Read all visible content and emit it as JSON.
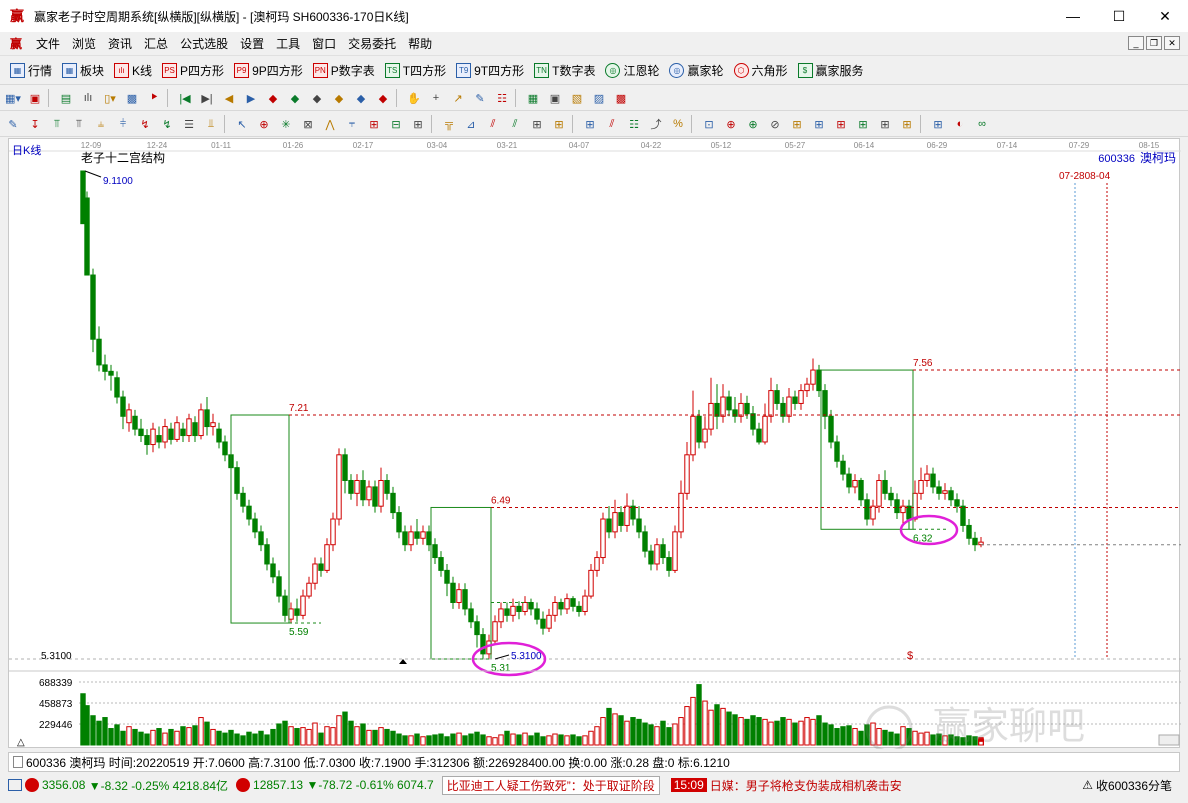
{
  "window": {
    "app_icon_glyph": "赢",
    "title": "赢家老子时空周期系统[纵横版][纵横版] - [澳柯玛  SH600336-170日K线]",
    "minimize": "—",
    "maximize": "☐",
    "close": "✕"
  },
  "menubar": {
    "logo_glyph": "赢",
    "items": [
      "文件",
      "浏览",
      "资讯",
      "汇总",
      "公式选股",
      "设置",
      "工具",
      "窗口",
      "交易委托",
      "帮助"
    ]
  },
  "toolbar1": [
    {
      "icon": "grid-icon",
      "glyph": "▦",
      "label": "行情",
      "tone": ""
    },
    {
      "icon": "blocks-icon",
      "glyph": "▦",
      "label": "板块",
      "tone": ""
    },
    {
      "icon": "candle-icon",
      "glyph": "ılı",
      "label": "K线",
      "tone": "r"
    },
    {
      "icon": "p-square-icon",
      "glyph": "PS",
      "label": "P四方形",
      "tone": "r"
    },
    {
      "icon": "9p-square-icon",
      "glyph": "P9",
      "label": "9P四方形",
      "tone": "r"
    },
    {
      "icon": "pn-table-icon",
      "glyph": "PN",
      "label": "P数字表",
      "tone": "r"
    },
    {
      "icon": "t-square-icon",
      "glyph": "TS",
      "label": "T四方形",
      "tone": "g"
    },
    {
      "icon": "9t-square-icon",
      "glyph": "T9",
      "label": "9T四方形",
      "tone": ""
    },
    {
      "icon": "tn-table-icon",
      "glyph": "TN",
      "label": "T数字表",
      "tone": "g"
    },
    {
      "icon": "gann-wheel-icon",
      "glyph": "◎",
      "label": "江恩轮",
      "tone": "g c"
    },
    {
      "icon": "winner-wheel-icon",
      "glyph": "◎",
      "label": "赢家轮",
      "tone": "c"
    },
    {
      "icon": "hexagon-icon",
      "glyph": "⬡",
      "label": "六角形",
      "tone": "r c"
    },
    {
      "icon": "dollar-icon",
      "glyph": "$",
      "label": "赢家服务",
      "tone": "g"
    }
  ],
  "toolbar2_glyphs": [
    "▦▾",
    "▣",
    "▤",
    "ılı",
    "▯▾",
    "▩",
    "⯈",
    "|◀",
    "▶|",
    "◀",
    "▶",
    "◆",
    "◆",
    "◆",
    "◆",
    "◆",
    "◆",
    "✋",
    "+",
    "↗",
    "✎",
    "☷",
    "▦",
    "▣",
    "▧",
    "▨",
    "▩"
  ],
  "toolbar3_glyphs": [
    "✎",
    "↧",
    "⫪",
    "⫪",
    "⫨",
    "⫩",
    "↯",
    "↯",
    "☰",
    "⫫",
    "↖",
    "⊕",
    "✳",
    "⊠",
    "⋀",
    "⫧",
    "⊞",
    "⊟",
    "⊞",
    "╦",
    "⊿",
    "⫽",
    "⫽",
    "⊞",
    "⊞",
    "⊞",
    "⫽",
    "☷",
    "⤴",
    "%",
    "⊡",
    "⊕",
    "⊕",
    "⊘",
    "⊞",
    "⊞",
    "⊞",
    "⊞",
    "⊞",
    "⊞",
    "⊞",
    "◐",
    "∞"
  ],
  "chart": {
    "period_label": "日K线",
    "structure_label": "老子十二宫结构",
    "symbol_right": "600336",
    "name_right": "澳柯玛",
    "date_range_label": "07-2808-04",
    "high_label": "9.1100",
    "low_label": "5.3100",
    "low_axis_label": "5.3100",
    "box_labels": [
      "7.21",
      "5.59",
      "6.49",
      "5.31",
      "7.56",
      "6.32"
    ],
    "dollar_mark": "$",
    "vol_ticks": [
      "688339",
      "458873",
      "229446"
    ],
    "watermark": "赢家聊吧",
    "colors": {
      "up": "#d00000",
      "down": "#008000",
      "box": "#1a8a1a",
      "level": "#c00000",
      "circle": "#e020d8",
      "grid": "#b8b8b8",
      "future": "#5b9bd5"
    },
    "x_dates": [
      "12-09",
      "12-24",
      "01-11",
      "01-26",
      "02-17",
      "03-04",
      "03-21",
      "04-07",
      "04-22",
      "05-12",
      "05-27",
      "06-14",
      "06-29",
      "07-14",
      "07-29",
      "08-15"
    ]
  },
  "infobar": {
    "text": "600336 澳柯玛 时间:20220519 开:7.0600 高:7.3100 低:7.0300 收:7.1900 手:312306 额:226928400.00 换:0.00 涨:0.28 盘:0 标:6.1210"
  },
  "statusbar": {
    "sh": "3356.08",
    "sh_change": "▼-8.32 -0.25% 4218.84亿",
    "sz": "12857.13",
    "sz_change": "▼-78.72 -0.61% 6074.7",
    "news1": "比亚迪工人疑工伤致死”：处于取证阶段",
    "time": "15:09",
    "news2": "日媒：男子将枪支伪装成相机袭击安",
    "right": "收600336分笔"
  }
}
